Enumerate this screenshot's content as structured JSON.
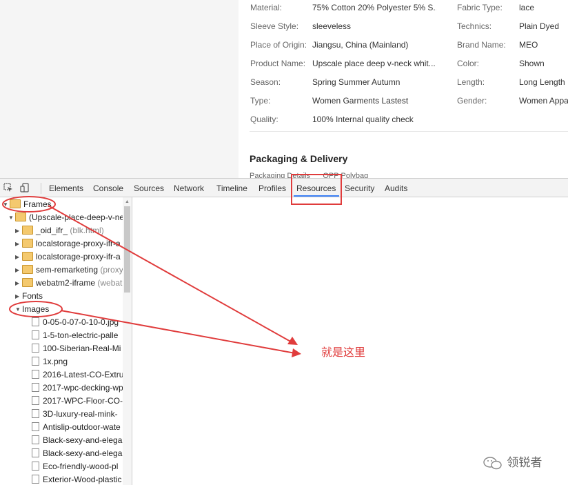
{
  "product": {
    "left_properties": [
      {
        "label": "Material:",
        "value": "75% Cotton 20% Polyester 5% S..."
      },
      {
        "label": "Sleeve Style:",
        "value": "sleeveless"
      },
      {
        "label": "Place of Origin:",
        "value": "Jiangsu, China (Mainland)"
      },
      {
        "label": "Product Name:",
        "value": "Upscale place deep v-neck whit..."
      },
      {
        "label": "Season:",
        "value": "Spring Summer Autumn"
      },
      {
        "label": "Type:",
        "value": "Women Garments Lastest"
      },
      {
        "label": "Quality:",
        "value": "100% Internal quality check"
      }
    ],
    "right_properties": [
      {
        "label": "Fabric Type:",
        "value": "lace"
      },
      {
        "label": "Technics:",
        "value": "Plain Dyed"
      },
      {
        "label": "Brand Name:",
        "value": "MEO"
      },
      {
        "label": "Color:",
        "value": "Shown"
      },
      {
        "label": "Length:",
        "value": "Long Length"
      },
      {
        "label": "Gender:",
        "value": "Women Appa"
      }
    ],
    "packaging_title": "Packaging & Delivery",
    "packaging_label": "Packaging Details",
    "packaging_value": "OPP Polybag"
  },
  "devtools": {
    "tabs": [
      "Elements",
      "Console",
      "Sources",
      "Network",
      "Timeline",
      "Profiles",
      "Resources",
      "Security",
      "Audits"
    ],
    "active_tab": "Resources",
    "tree": {
      "frames_label": "Frames",
      "top_frame": "(Upscale-place-deep-v-ne",
      "subframes": [
        {
          "name": "_oid_ifr_",
          "extra": "(blk.html)"
        },
        {
          "name": "localstorage-proxy-ifr-a",
          "extra": ""
        },
        {
          "name": "localstorage-proxy-ifr-a",
          "extra": ""
        },
        {
          "name": "sem-remarketing",
          "extra": "(proxy"
        },
        {
          "name": "webatm2-iframe",
          "extra": "(webat"
        }
      ],
      "fonts_label": "Fonts",
      "images_label": "Images",
      "images": [
        "0-05-0-07-0-10-0.jpg",
        "1-5-ton-electric-palle",
        "100-Siberian-Real-Mi",
        "1x.png",
        "2016-Latest-CO-Extru",
        "2017-wpc-decking-wp",
        "2017-WPC-Floor-CO-",
        "3D-luxury-real-mink-",
        "Antislip-outdoor-wate",
        "Black-sexy-and-elega",
        "Black-sexy-and-elega",
        "Eco-friendly-wood-pl",
        "Exterior-Wood-plastic"
      ]
    }
  },
  "annotation": {
    "note": "就是这里",
    "color": "#e03c3c"
  },
  "watermark": "领锐者"
}
